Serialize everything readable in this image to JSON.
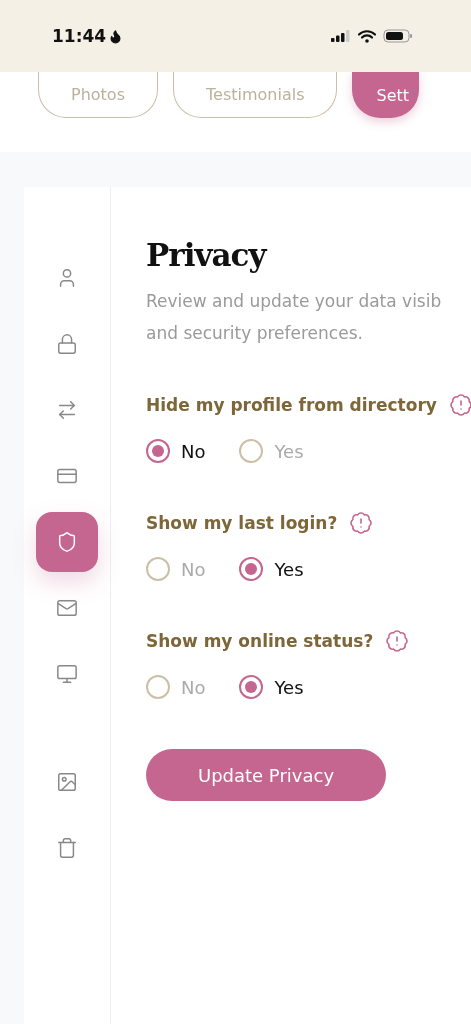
{
  "status_bar": {
    "time": "11:44"
  },
  "tabs": [
    {
      "label": "Photos",
      "selected": false
    },
    {
      "label": "Testimonials",
      "selected": false
    },
    {
      "label": "Sett",
      "selected": true
    }
  ],
  "sidebar": {
    "items": [
      {
        "kind": "user",
        "selected": false
      },
      {
        "kind": "lock",
        "selected": false
      },
      {
        "kind": "exchange",
        "selected": false
      },
      {
        "kind": "card",
        "selected": false
      },
      {
        "kind": "shield",
        "selected": true
      },
      {
        "kind": "mail",
        "selected": false
      },
      {
        "kind": "monitor",
        "selected": false
      }
    ],
    "extra_items": [
      {
        "kind": "image",
        "selected": false
      },
      {
        "kind": "trash",
        "selected": false
      }
    ]
  },
  "title": "Privacy",
  "description_lines": [
    "Review and update your data visib",
    "and security preferences."
  ],
  "questions": [
    {
      "label": "Hide my profile from directory",
      "options": [
        {
          "label": "No",
          "selected": true
        },
        {
          "label": "Yes",
          "selected": false
        }
      ]
    },
    {
      "label": "Show my last login?",
      "options": [
        {
          "label": "No",
          "selected": false
        },
        {
          "label": "Yes",
          "selected": true
        }
      ]
    },
    {
      "label": "Show my online status?",
      "options": [
        {
          "label": "No",
          "selected": false
        },
        {
          "label": "Yes",
          "selected": true
        }
      ]
    }
  ],
  "submit_button": "Update Privacy"
}
